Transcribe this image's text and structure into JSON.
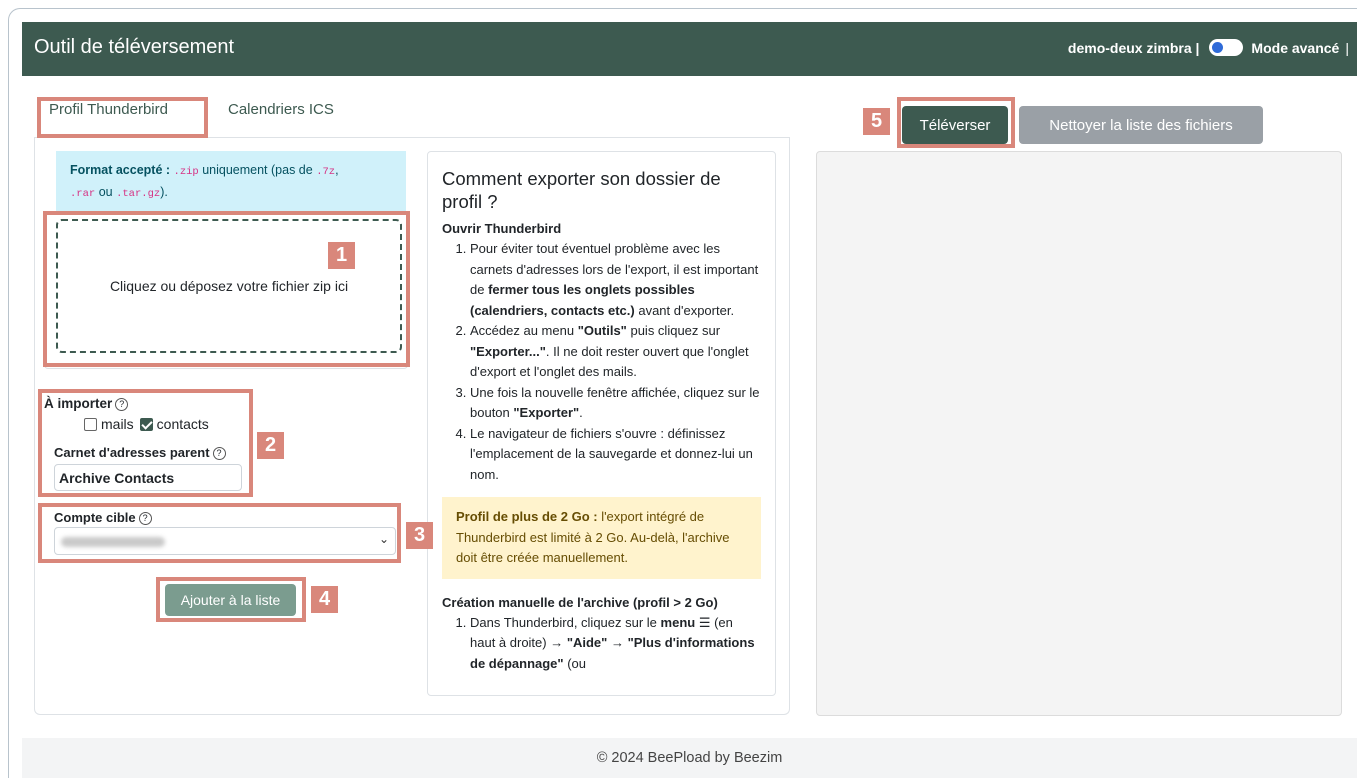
{
  "header": {
    "title": "Outil de téléversement",
    "user": "demo-deux zimbra |",
    "mode_label": "Mode avancé",
    "separator": "|"
  },
  "tabs": [
    {
      "label": "Profil Thunderbird",
      "active": true
    },
    {
      "label": "Calendriers ICS",
      "active": false
    }
  ],
  "info": {
    "label": "Format accepté :",
    "zip": ".zip",
    "text1": " uniquement (pas de ",
    "seven": ".7z",
    "comma": ",",
    "rar": ".rar",
    "or": " ou ",
    "targz": ".tar.gz",
    "end": ")."
  },
  "dropzone": {
    "text": "Cliquez ou déposez votre fichier zip ici"
  },
  "import": {
    "label": "À importer",
    "mails": "mails",
    "mails_checked": false,
    "contacts": "contacts",
    "contacts_checked": true
  },
  "addressbook": {
    "label": "Carnet d'adresses parent",
    "value": "Archive Contacts"
  },
  "account": {
    "label": "Compte cible"
  },
  "add_button": "Ajouter à la liste",
  "help_glyph": "?",
  "badges": [
    "1",
    "2",
    "3",
    "4",
    "5"
  ],
  "howto": {
    "title": "Comment exporter son dossier de profil ?",
    "open": "Ouvrir Thunderbird",
    "step1_a": "Pour éviter tout éventuel problème avec les carnets d'adresses lors de l'export, il est important de ",
    "step1_b": "fermer tous les onglets possibles (calendriers, contacts etc.)",
    "step1_c": " avant d'exporter.",
    "step2_a": "Accédez au menu ",
    "step2_b": "\"Outils\"",
    "step2_c": " puis cliquez sur ",
    "step2_d": "\"Exporter...\"",
    "step2_e": ". Il ne doit rester ouvert que l'onglet d'export et l'onglet des mails.",
    "step3_a": "Une fois la nouvelle fenêtre affichée, cliquez sur le bouton ",
    "step3_b": "\"Exporter\"",
    "step3_c": ".",
    "step4": "Le navigateur de fichiers s'ouvre : définissez l'emplacement de la sauvegarde et donnez-lui un nom.",
    "warn_b": "Profil de plus de 2 Go :",
    "warn_t": " l'export intégré de Thunderbird est limité à 2 Go. Au-delà, l'archive doit être créée manuellement.",
    "manual": "Création manuelle de l'archive (profil > 2 Go)",
    "m1_a": "Dans Thunderbird, cliquez sur le ",
    "m1_b": "menu ☰",
    "m1_c": " (en haut à droite) → ",
    "m1_d": "\"Aide\"",
    "m1_e": " → ",
    "m1_f": "\"Plus d'informations de dépannage\"",
    "m1_g": " (ou"
  },
  "upload_button": "Téléverser",
  "clear_button": "Nettoyer la liste des fichiers",
  "footer": "© 2024 BeePload by Beezim",
  "colors": {
    "navbar": "#3d5a50",
    "highlight": "#d9877b",
    "info_bg": "#d0f1fa",
    "warn_bg": "#fff3cd"
  }
}
